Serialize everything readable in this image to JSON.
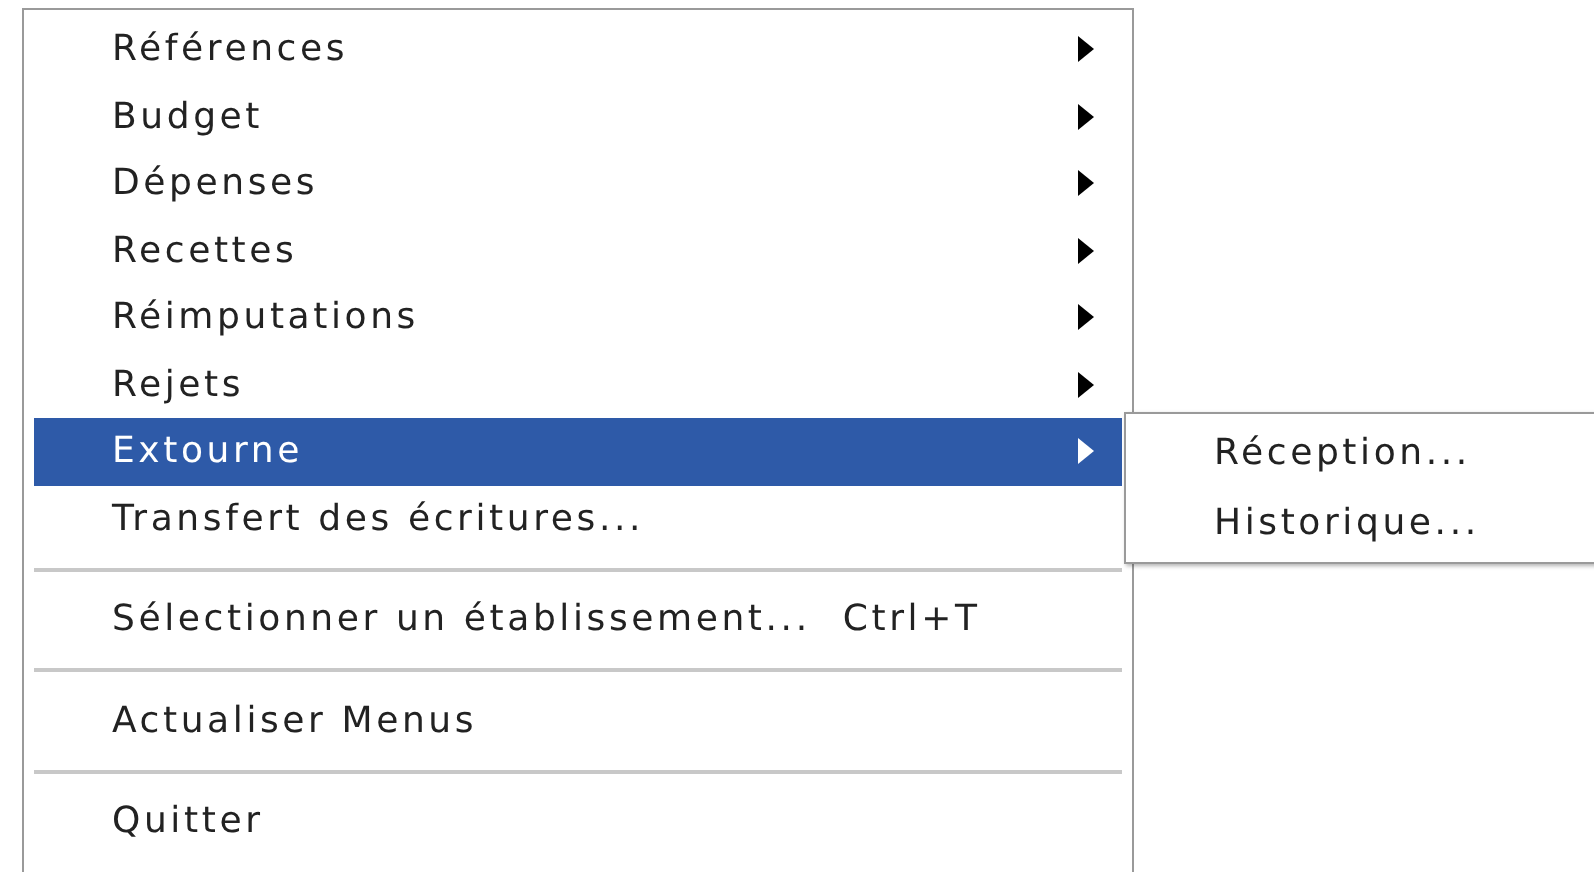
{
  "menu": {
    "items": [
      {
        "kind": "item",
        "label": "Références",
        "submenu": true,
        "selected": false
      },
      {
        "kind": "item",
        "label": "Budget",
        "submenu": true,
        "selected": false
      },
      {
        "kind": "item",
        "label": "Dépenses",
        "submenu": true,
        "selected": false
      },
      {
        "kind": "item",
        "label": "Recettes",
        "submenu": true,
        "selected": false
      },
      {
        "kind": "item",
        "label": "Réimputations",
        "submenu": true,
        "selected": false
      },
      {
        "kind": "item",
        "label": "Rejets",
        "submenu": true,
        "selected": false
      },
      {
        "kind": "item",
        "label": "Extourne",
        "submenu": true,
        "selected": true
      },
      {
        "kind": "item",
        "label": "Transfert des écritures...",
        "submenu": false,
        "selected": false
      },
      {
        "kind": "separator"
      },
      {
        "kind": "item",
        "label": "Sélectionner un établissement...",
        "shortcut": "Ctrl+T",
        "submenu": false,
        "selected": false
      },
      {
        "kind": "separator"
      },
      {
        "kind": "item",
        "label": "Actualiser Menus",
        "submenu": false,
        "selected": false
      },
      {
        "kind": "separator"
      },
      {
        "kind": "item",
        "label": "Quitter",
        "submenu": false,
        "selected": false
      }
    ]
  },
  "submenu": {
    "items": [
      {
        "label": "Réception..."
      },
      {
        "label": "Historique..."
      }
    ]
  }
}
